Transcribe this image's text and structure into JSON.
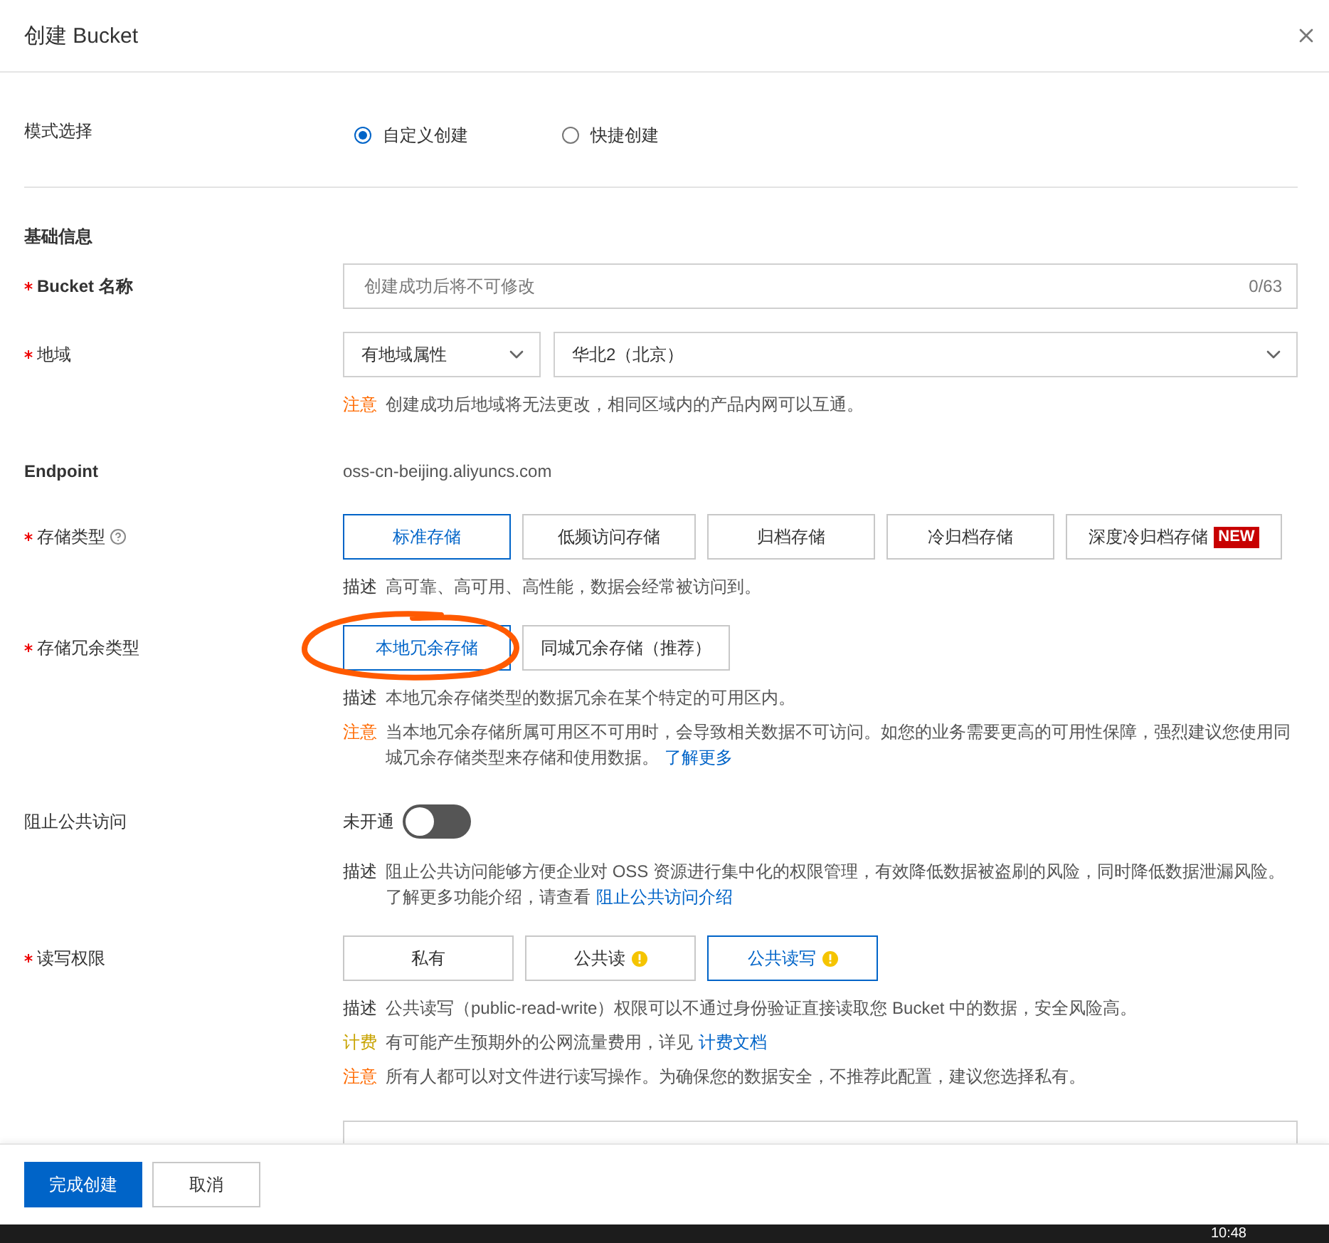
{
  "dialog": {
    "title": "创建 Bucket"
  },
  "mode": {
    "label": "模式选择",
    "options": [
      {
        "label": "自定义创建",
        "selected": true
      },
      {
        "label": "快捷创建",
        "selected": false
      }
    ]
  },
  "section_title": "基础信息",
  "bucket_name": {
    "label": "Bucket 名称",
    "required": true,
    "placeholder": "创建成功后将不可修改",
    "counter": "0/63"
  },
  "region": {
    "label": "地域",
    "required": true,
    "selects": [
      "有地域属性",
      "华北2（北京）"
    ],
    "notes": [
      {
        "kind": "warning",
        "tag": "注意",
        "text": "创建成功后地域将无法更改，相同区域内的产品内网可以互通。"
      }
    ]
  },
  "endpoint": {
    "label": "Endpoint",
    "value": "oss-cn-beijing.aliyuncs.com"
  },
  "storage_class": {
    "label": "存储类型",
    "required": true,
    "help": true,
    "options": [
      {
        "label": "标准存储",
        "selected": true
      },
      {
        "label": "低频访问存储",
        "selected": false
      },
      {
        "label": "归档存储",
        "selected": false
      },
      {
        "label": "冷归档存储",
        "selected": false
      },
      {
        "label": "深度冷归档存储",
        "selected": false,
        "badge": "NEW"
      }
    ],
    "notes": [
      {
        "kind": "desc",
        "tag": "描述",
        "text": "高可靠、高可用、高性能，数据会经常被访问到。"
      }
    ]
  },
  "redundancy": {
    "label": "存储冗余类型",
    "required": true,
    "options": [
      {
        "label": "本地冗余存储",
        "selected": true
      },
      {
        "label": "同城冗余存储（推荐）",
        "selected": false
      }
    ],
    "notes": [
      {
        "kind": "desc",
        "tag": "描述",
        "text": "本地冗余存储类型的数据冗余在某个特定的可用区内。"
      },
      {
        "kind": "warning",
        "tag": "注意",
        "text": "当本地冗余存储所属可用区不可用时，会导致相关数据不可访问。如您的业务需要更高的可用性保障，强烈建议您使用同城冗余存储类型来存储和使用数据。",
        "link": "了解更多"
      }
    ]
  },
  "block_public_access": {
    "label": "阻止公共访问",
    "status": "未开通",
    "on": false,
    "notes": [
      {
        "kind": "desc",
        "tag": "描述",
        "text": "阻止公共访问能够方便企业对 OSS 资源进行集中化的权限管理，有效降低数据被盗刷的风险，同时降低数据泄漏风险。了解更多功能介绍，请查看",
        "link": "阻止公共访问介绍"
      }
    ]
  },
  "acl": {
    "label": "读写权限",
    "required": true,
    "options": [
      {
        "label": "私有",
        "selected": false,
        "warning": false
      },
      {
        "label": "公共读",
        "selected": false,
        "warning": true
      },
      {
        "label": "公共读写",
        "selected": true,
        "warning": true
      }
    ],
    "notes": [
      {
        "kind": "desc",
        "tag": "描述",
        "text": "公共读写（public-read-write）权限可以不通过身份验证直接读取您 Bucket 中的数据，安全风险高。"
      },
      {
        "kind": "billing",
        "tag": "计费",
        "text": "有可能产生预期外的公网流量费用，详见",
        "link": "计费文档"
      },
      {
        "kind": "warning",
        "tag": "注意",
        "text": "所有人都可以对文件进行读写操作。为确保您的数据安全，不推荐此配置，建议您选择私有。"
      }
    ]
  },
  "footer_buttons": [
    {
      "label": "完成创建",
      "kind": "primary"
    },
    {
      "label": "取消",
      "kind": "secondary"
    }
  ],
  "taskbar": {
    "clock": "10:48"
  }
}
